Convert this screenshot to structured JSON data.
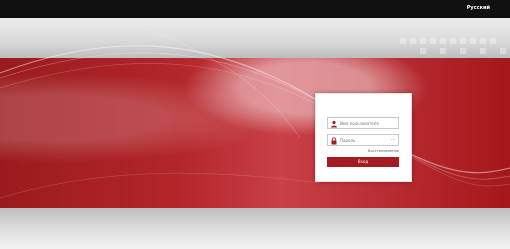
{
  "header": {
    "language_label": "Русский"
  },
  "login": {
    "username_placeholder": "Имя пользователя",
    "password_placeholder": "Пароль",
    "forgot_password_label": "Восстановление",
    "submit_label": "Вход"
  },
  "colors": {
    "brand_red": "#a51b22",
    "topbar": "#111111"
  }
}
